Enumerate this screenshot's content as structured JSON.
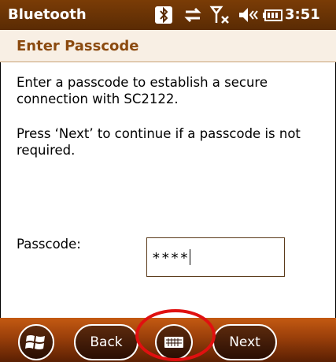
{
  "statusbar": {
    "title": "Bluetooth",
    "time": "3:51",
    "icons": [
      "bluetooth-icon",
      "sync-icon",
      "signal-off-icon",
      "volume-muted-icon",
      "battery-icon"
    ]
  },
  "header": {
    "title": "Enter Passcode"
  },
  "content": {
    "para1": "Enter a passcode to establish a secure connection with SC2122.",
    "para2": "Press ‘Next’ to continue if a passcode is not required.",
    "passcode_label": "Passcode:",
    "passcode_value": "****"
  },
  "bottombar": {
    "back_label": "Back",
    "next_label": "Next",
    "start_icon": "windows-icon",
    "keyboard_icon": "keyboard-icon"
  },
  "colors": {
    "statusbar": "#5a2b04",
    "header_bg": "#f8efe4",
    "header_text": "#8b4a0f",
    "bottombar": "#9a3f0a",
    "highlight": "#e01010"
  }
}
